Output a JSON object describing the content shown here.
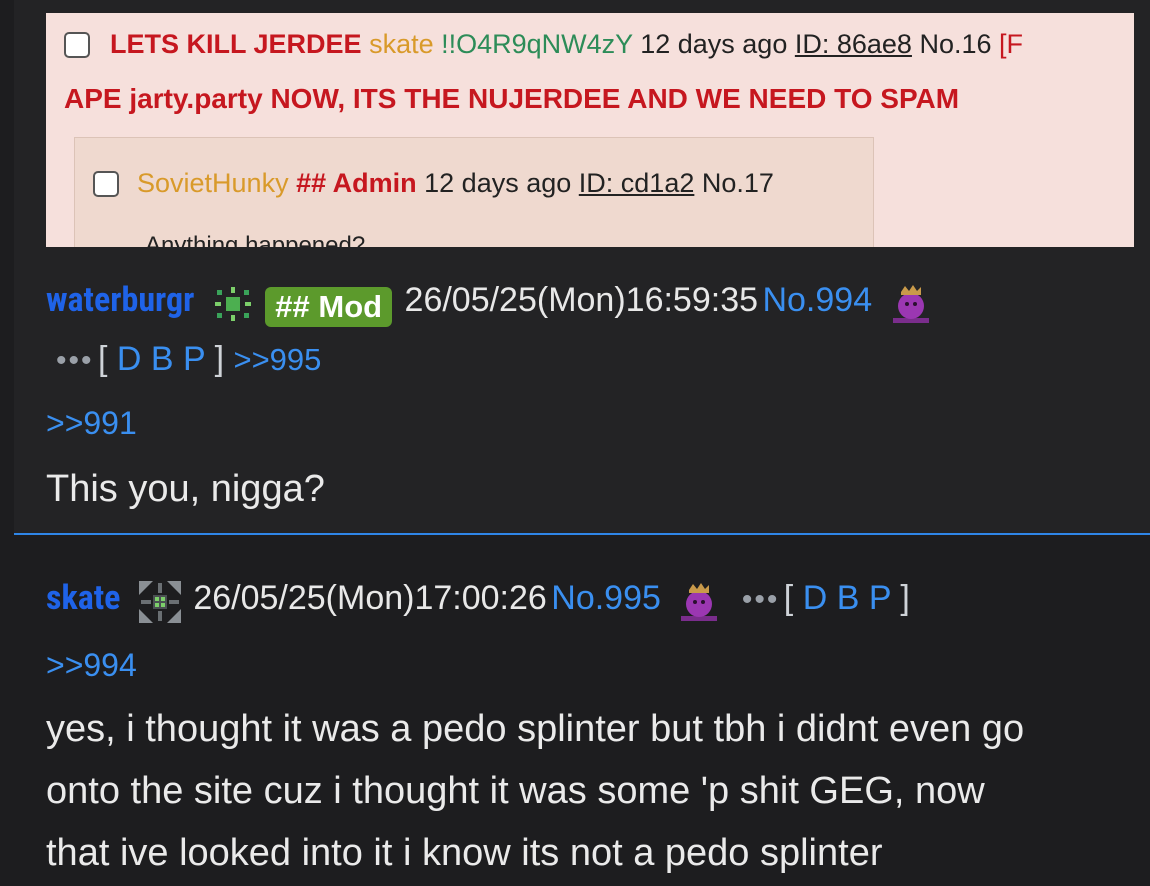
{
  "embed": {
    "post1": {
      "subject": "LETS KILL JERDEE",
      "name": "skate",
      "trip": "!!O4R9qNW4zY",
      "time": "12 days ago",
      "id": "ID: 86ae8",
      "number": "No.16",
      "bracket": "[F",
      "body": "APE jarty.party NOW, ITS THE NUJERDEE AND WE NEED TO SPAM"
    },
    "post2": {
      "name": "SovietHunky",
      "role": "## Admin",
      "time": "12 days ago",
      "id": "ID: cd1a2",
      "number": "No.17",
      "body": "Anything happened?"
    }
  },
  "posts": [
    {
      "name": "waterburgr",
      "flag_icon": "green-pixel-flag-icon",
      "badge": "## Mod",
      "date": "26/05/25(Mon)16:59:35",
      "number": "No.994",
      "avatar_icon": "purple-mascot-icon",
      "dots": "•••",
      "actions": [
        "[",
        "D",
        "B",
        "P",
        "]"
      ],
      "backlink": ">>995",
      "quote": ">>991",
      "body": "This you, nigga?"
    },
    {
      "name": "skate",
      "flag_icon": "grey-green-pixel-flag-icon",
      "date": "26/05/25(Mon)17:00:26",
      "number": "No.995",
      "avatar_icon": "purple-mascot-icon",
      "dots": "•••",
      "actions": [
        "[",
        "D",
        "B",
        "P",
        "]"
      ],
      "quote": ">>994",
      "body_lines": [
        "yes, i thought it was a pedo splinter but tbh i didnt even go",
        "onto the site cuz i thought it was some 'p shit GEG, now",
        "that ive looked into it i know its not a pedo splinter"
      ]
    }
  ],
  "colors": {
    "background": "#1d1d1f",
    "name": "#1f63e8",
    "link": "#3a8ff0",
    "mod_badge": "#5c9a2c",
    "separator": "#2f86e8"
  }
}
